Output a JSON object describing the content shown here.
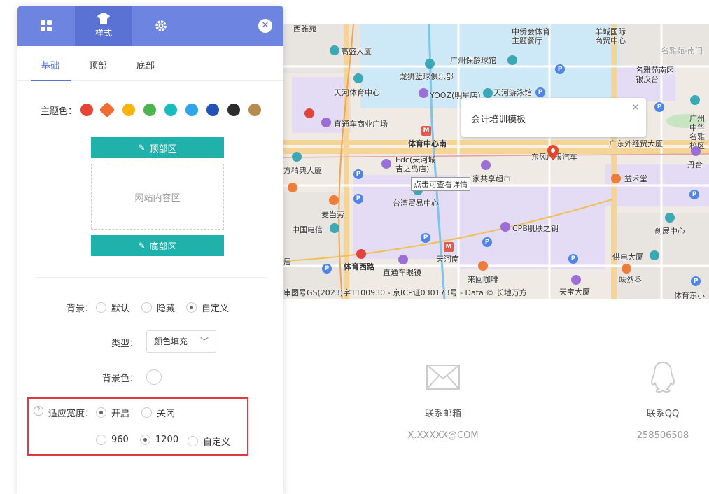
{
  "panel": {
    "tabs": [
      {
        "icon": "grid-icon",
        "label": ""
      },
      {
        "icon": "shirt-icon",
        "label": "样式"
      },
      {
        "icon": "gear-icon",
        "label": ""
      }
    ],
    "close_icon": "close-icon",
    "subtabs": [
      "基础",
      "顶部",
      "底部"
    ],
    "theme_label": "主题色：",
    "theme_colors": [
      "#e84335",
      "#f46c2f",
      "#f6b40c",
      "#4cb34e",
      "#18bcbd",
      "#2ea4ea",
      "#2351b5",
      "#2c2c2c",
      "#b48c50"
    ],
    "header_zone": "顶部区",
    "content_zone": "网站内容区",
    "footer_zone": "底部区",
    "background": {
      "label": "背景：",
      "options": [
        "默认",
        "隐藏",
        "自定义"
      ],
      "selected": "自定义"
    },
    "type": {
      "label": "类型：",
      "value": "颜色填充"
    },
    "bg_color_label": "背景色：",
    "adapt_width": {
      "label": "适应宽度：",
      "options": [
        "开启",
        "关闭"
      ],
      "selected": "开启",
      "widths": [
        "960",
        "1200",
        "自定义"
      ],
      "selected_width": "1200"
    },
    "help_icon": "question-icon"
  },
  "map": {
    "popup_title": "会计培训模板",
    "tooltip": "点击可查看详情",
    "copyright": "审图号GS(2023)字1100930 - 京ICP证030173号 - Data © 长地万方",
    "labels": {
      "xiyayuan": "西雅苑",
      "zhongqiao": "中侨会体育\n主题餐厅",
      "yangcheng": "羊城国际\n商贸中心",
      "mingyayuan": "名雅苑-南门",
      "gaosheng": "高盛大厦",
      "baoling": "广州保龄球馆",
      "minyayuannan": "名雅苑南区\n银汉台",
      "longshi": "龙狮篮球俱乐部",
      "tianhe_sports": "天河体育中心",
      "yooz": "YOOZ(明星店)",
      "swimming": "天河游泳馆",
      "guangzhou_zhong": "广州中华\n名雅校区",
      "zhitong": "直通车商业广场",
      "sports_center_south": "体育中心南",
      "dongfeng": "东风广根汽车",
      "guangdong_waijing": "广东外经贸大厦",
      "edc": "Edc(天河城\n吉之岛店)",
      "jiahua": "家共享超市",
      "dandan": "丹合",
      "jingpin": "方精典大厦",
      "yihemei": "益禾堂",
      "taiwan": "台湾贸易中心",
      "maidanglao": "麦当劳",
      "zhongguo_dianxin": "中国电信",
      "cpb": "CPB肌肤之钥",
      "chuangzhan": "创展中心",
      "tianhe_nan": "天河南",
      "gongdian": "供电大厦",
      "ju": "居",
      "sports_west": "体育西路",
      "zhitong_glasses": "直通车眼镜",
      "laihui": "来回咖啡",
      "weiranxiang": "味然香",
      "tianbao": "天宝大厦",
      "sports_east": "体育东小"
    }
  },
  "contacts": [
    {
      "icon": "mail-icon",
      "label": "联系邮箱",
      "value": "X.XXXXX@COM"
    },
    {
      "icon": "qq-icon",
      "label": "联系QQ",
      "value": "258506508"
    }
  ]
}
